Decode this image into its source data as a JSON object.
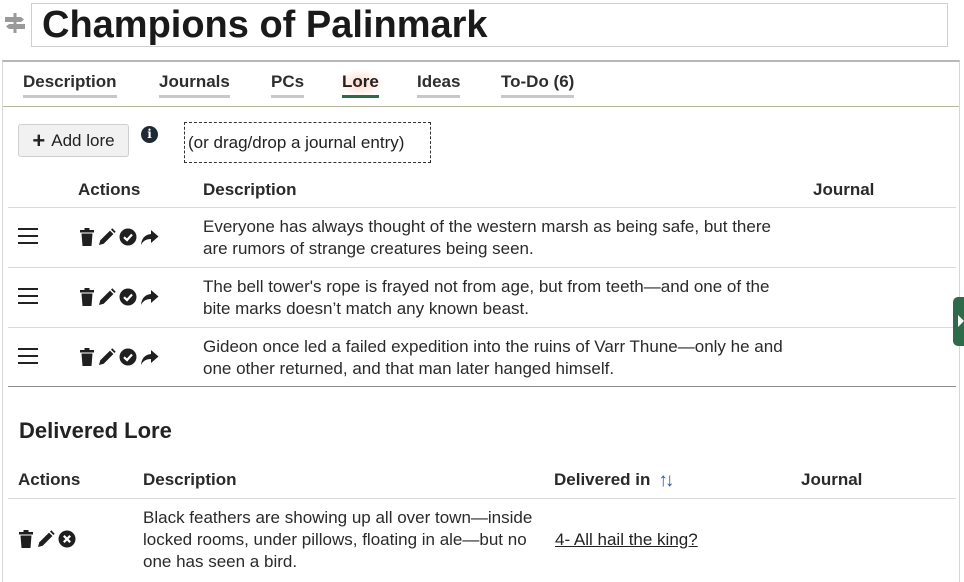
{
  "header": {
    "title": "Champions of Palinmark",
    "icon": "signpost-icon"
  },
  "tabs": [
    {
      "label": "Description",
      "active": false
    },
    {
      "label": "Journals",
      "active": false
    },
    {
      "label": "PCs",
      "active": false
    },
    {
      "label": "Lore",
      "active": true
    },
    {
      "label": "Ideas",
      "active": false
    },
    {
      "label": "To-Do (6)",
      "active": false
    }
  ],
  "lore": {
    "add_button_label": "Add lore",
    "drop_hint": "(or drag/drop a journal entry)",
    "columns": {
      "actions": "Actions",
      "description": "Description",
      "journal": "Journal"
    },
    "rows": [
      {
        "description": "Everyone has always thought of the western marsh as being safe, but there are rumors of strange creatures being seen.",
        "journal": ""
      },
      {
        "description": "The bell tower's rope is frayed not from age, but from teeth—and one of the bite marks doesn’t match any known beast.",
        "journal": ""
      },
      {
        "description": "Gideon once led a failed expedition into the ruins of Varr Thune—only he and one other returned, and that man later hanged himself.",
        "journal": ""
      }
    ]
  },
  "delivered": {
    "title": "Delivered Lore",
    "columns": {
      "actions": "Actions",
      "description": "Description",
      "delivered_in": "Delivered in",
      "journal": "Journal"
    },
    "rows": [
      {
        "description": "Black feathers are showing up all over town—inside locked rooms, under pillows, floating in ale—but no one has seen a bird.",
        "delivered_in": "4- All hail the king?",
        "journal": ""
      }
    ]
  },
  "colors": {
    "accent": "#2e6b48",
    "sort_icon": "#2d5d9a"
  }
}
